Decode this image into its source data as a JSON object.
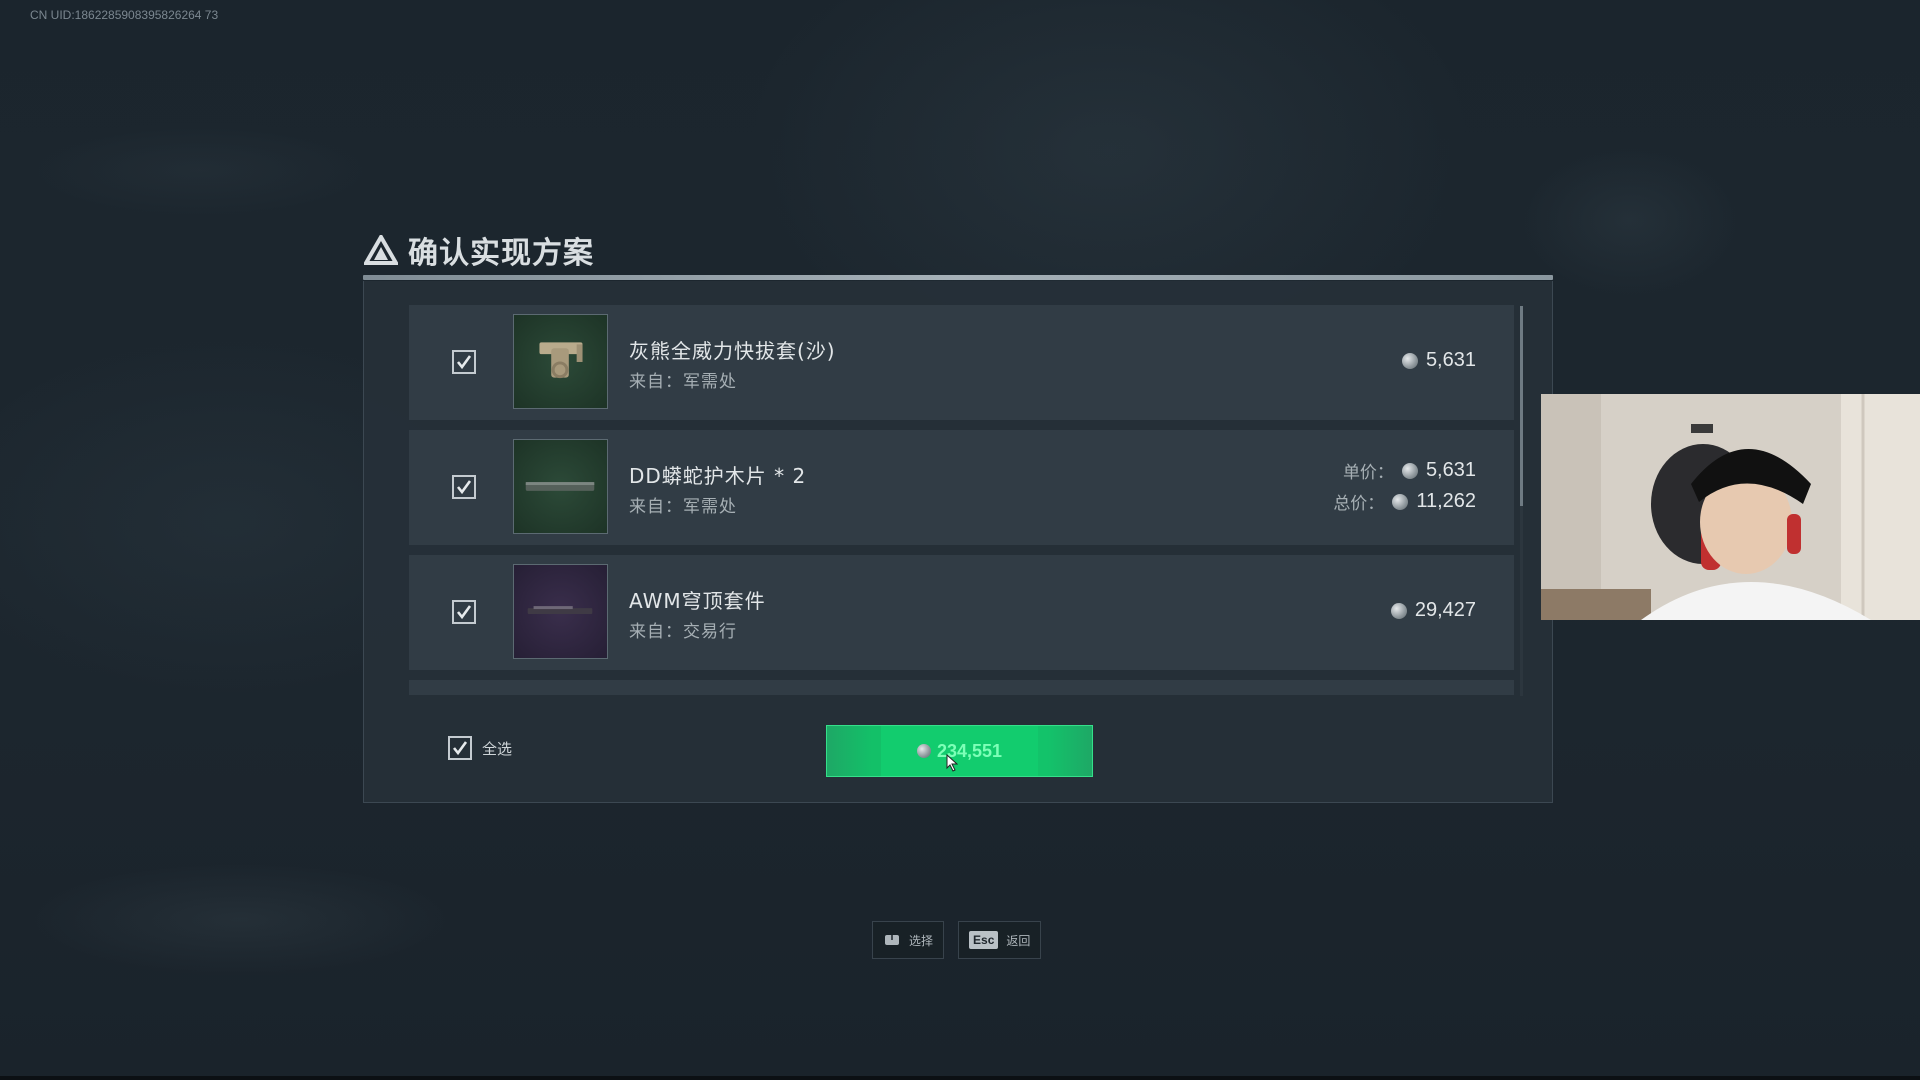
{
  "uid_text": "CN UID:1862285908395826264 73",
  "panel": {
    "title": "确认实现方案"
  },
  "items": [
    {
      "name": "灰熊全威力快拔套(沙)",
      "source": "来自：军需处",
      "price": "5,631",
      "thumb_color": "green",
      "checked": true
    },
    {
      "name": "DD蟒蛇护木片 * 2",
      "source": "来自：军需处",
      "unit_price_label": "单价：",
      "unit_price": "5,631",
      "total_price_label": "总价：",
      "total_price": "11,262",
      "thumb_color": "green",
      "checked": true
    },
    {
      "name": "AWM穹顶套件",
      "source": "来自：交易行",
      "price": "29,427",
      "thumb_color": "purple",
      "checked": true
    }
  ],
  "select_all": {
    "label": "全选",
    "checked": true
  },
  "confirm_button": {
    "amount": "234,551"
  },
  "hints": [
    {
      "icon": "mouse-icon",
      "label": "选择"
    },
    {
      "key": "Esc",
      "label": "返回"
    }
  ],
  "colors": {
    "accent_green": "#13c36a",
    "amount_text": "#7dffb7",
    "background": "#1a222a"
  }
}
